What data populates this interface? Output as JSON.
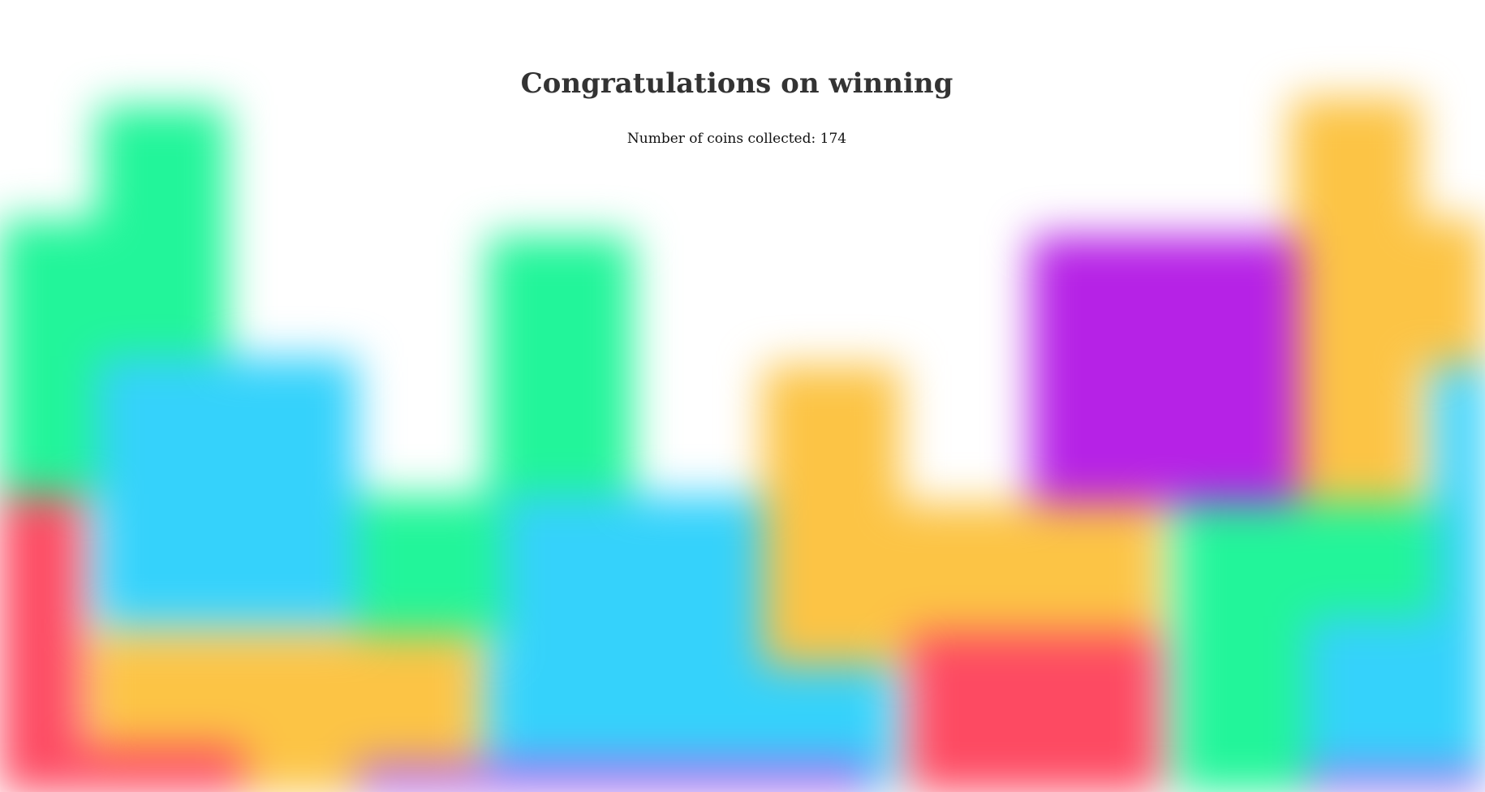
{
  "screen": "win",
  "title": "Congratulations on winning",
  "coins": {
    "label": "Number of coins collected:",
    "count": 174
  },
  "palette": {
    "green": "#22f59a",
    "blue": "#35d2fb",
    "yellow": "#fcc445",
    "purple": "#b622e6",
    "red": "#fd4a62",
    "violet": "#b05ef0",
    "background": "#ffffff"
  }
}
